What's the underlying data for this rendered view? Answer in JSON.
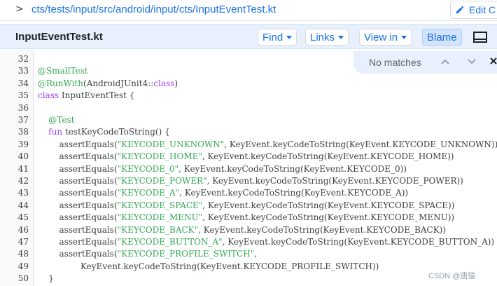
{
  "breadcrumb": {
    "path": "cts/tests/input/src/android/input/cts/InputEventTest.kt",
    "edit_label": "Edit C"
  },
  "file_header": {
    "title": "InputEventTest.kt",
    "find_label": "Find",
    "links_label": "Links",
    "view_in_label": "View in",
    "blame_label": "Blame"
  },
  "find_bar": {
    "status": "No matches"
  },
  "code": {
    "lines": [
      {
        "n": "32",
        "parts": []
      },
      {
        "n": "33",
        "parts": [
          {
            "t": "@SmallTest",
            "c": "annot"
          }
        ]
      },
      {
        "n": "34",
        "parts": [
          {
            "t": "@RunWith",
            "c": "annot"
          },
          {
            "t": "(AndroidJUnit4::",
            "c": "plain"
          },
          {
            "t": "class",
            "c": "kw"
          },
          {
            "t": ")",
            "c": "plain"
          }
        ]
      },
      {
        "n": "35",
        "parts": [
          {
            "t": "class",
            "c": "kw"
          },
          {
            "t": " InputEventTest {",
            "c": "plain"
          }
        ]
      },
      {
        "n": "36",
        "parts": []
      },
      {
        "n": "37",
        "parts": [
          {
            "t": "    ",
            "c": "plain"
          },
          {
            "t": "@Test",
            "c": "annot"
          }
        ]
      },
      {
        "n": "38",
        "parts": [
          {
            "t": "    ",
            "c": "plain"
          },
          {
            "t": "fun",
            "c": "kw"
          },
          {
            "t": " testKeyCodeToString() {",
            "c": "plain"
          }
        ]
      },
      {
        "n": "39",
        "parts": [
          {
            "t": "        assertEquals(",
            "c": "plain"
          },
          {
            "t": "\"KEYCODE_UNKNOWN\"",
            "c": "str"
          },
          {
            "t": ", KeyEvent.keyCodeToString(KeyEvent.KEYCODE_UNKNOWN))",
            "c": "plain"
          }
        ]
      },
      {
        "n": "40",
        "parts": [
          {
            "t": "        assertEquals(",
            "c": "plain"
          },
          {
            "t": "\"KEYCODE_HOME\"",
            "c": "str"
          },
          {
            "t": ", KeyEvent.keyCodeToString(KeyEvent.KEYCODE_HOME))",
            "c": "plain"
          }
        ]
      },
      {
        "n": "41",
        "parts": [
          {
            "t": "        assertEquals(",
            "c": "plain"
          },
          {
            "t": "\"KEYCODE_0\"",
            "c": "str"
          },
          {
            "t": ", KeyEvent.keyCodeToString(KeyEvent.KEYCODE_0))",
            "c": "plain"
          }
        ]
      },
      {
        "n": "42",
        "parts": [
          {
            "t": "        assertEquals(",
            "c": "plain"
          },
          {
            "t": "\"KEYCODE_POWER\"",
            "c": "str"
          },
          {
            "t": ", KeyEvent.keyCodeToString(KeyEvent.KEYCODE_POWER))",
            "c": "plain"
          }
        ]
      },
      {
        "n": "43",
        "parts": [
          {
            "t": "        assertEquals(",
            "c": "plain"
          },
          {
            "t": "\"KEYCODE_A\"",
            "c": "str"
          },
          {
            "t": ", KeyEvent.keyCodeToString(KeyEvent.KEYCODE_A))",
            "c": "plain"
          }
        ]
      },
      {
        "n": "44",
        "parts": [
          {
            "t": "        assertEquals(",
            "c": "plain"
          },
          {
            "t": "\"KEYCODE_SPACE\"",
            "c": "str"
          },
          {
            "t": ", KeyEvent.keyCodeToString(KeyEvent.KEYCODE_SPACE))",
            "c": "plain"
          }
        ]
      },
      {
        "n": "45",
        "parts": [
          {
            "t": "        assertEquals(",
            "c": "plain"
          },
          {
            "t": "\"KEYCODE_MENU\"",
            "c": "str"
          },
          {
            "t": ", KeyEvent.keyCodeToString(KeyEvent.KEYCODE_MENU))",
            "c": "plain"
          }
        ]
      },
      {
        "n": "46",
        "parts": [
          {
            "t": "        assertEquals(",
            "c": "plain"
          },
          {
            "t": "\"KEYCODE_BACK\"",
            "c": "str"
          },
          {
            "t": ", KeyEvent.keyCodeToString(KeyEvent.KEYCODE_BACK))",
            "c": "plain"
          }
        ]
      },
      {
        "n": "47",
        "parts": [
          {
            "t": "        assertEquals(",
            "c": "plain"
          },
          {
            "t": "\"KEYCODE_BUTTON_A\"",
            "c": "str"
          },
          {
            "t": ", KeyEvent.keyCodeToString(KeyEvent.KEYCODE_BUTTON_A))",
            "c": "plain"
          }
        ]
      },
      {
        "n": "48",
        "parts": [
          {
            "t": "        assertEquals(",
            "c": "plain"
          },
          {
            "t": "\"KEYCODE_PROFILE_SWITCH\"",
            "c": "str"
          },
          {
            "t": ",",
            "c": "plain"
          }
        ]
      },
      {
        "n": "49",
        "parts": [
          {
            "t": "                KeyEvent.keyCodeToString(KeyEvent.KEYCODE_PROFILE_SWITCH))",
            "c": "plain"
          }
        ]
      },
      {
        "n": "50",
        "parts": [
          {
            "t": "    }",
            "c": "plain"
          }
        ]
      }
    ]
  },
  "watermark": "CSDN @唐猿",
  "colors": {
    "link": "#1a73e8",
    "header_bg": "#e8f0fe",
    "annotation": "#34a853",
    "string": "#34a853",
    "keyword": "#a142f4"
  },
  "icons": {
    "crumb": "chevron-right-icon",
    "edit": "pencil-icon",
    "layout": "panel-layout-icon",
    "find_prev": "chevron-up-icon",
    "find_next": "chevron-down-icon",
    "find_close": "close-icon"
  }
}
